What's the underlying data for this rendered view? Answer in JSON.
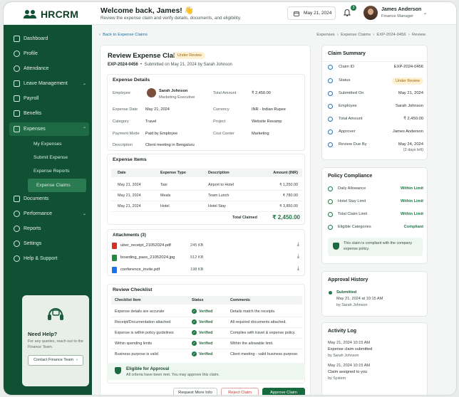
{
  "app": {
    "name": "HRCRM"
  },
  "header": {
    "welcome": "Welcome back, James! 👋",
    "subtitle": "Review the expense claim and verify details, documents, and eligibility.",
    "date": "May 21, 2024",
    "notification_count": "3",
    "user_name": "James Anderson",
    "user_role": "Finance Manager"
  },
  "sidebar": {
    "items": [
      {
        "label": "Dashboard"
      },
      {
        "label": "Profile"
      },
      {
        "label": "Attendance"
      },
      {
        "label": "Leave Management"
      },
      {
        "label": "Payroll"
      },
      {
        "label": "Benefits"
      },
      {
        "label": "Expenses"
      },
      {
        "label": "Documents"
      },
      {
        "label": "Performance"
      },
      {
        "label": "Reports"
      },
      {
        "label": "Settings"
      },
      {
        "label": "Help & Support"
      }
    ],
    "expenses_sub": [
      {
        "label": "My Expenses"
      },
      {
        "label": "Submit Expense"
      },
      {
        "label": "Expense Reports"
      },
      {
        "label": "Expense Claims"
      }
    ],
    "help": {
      "title": "Need Help?",
      "text": "For any queries, reach out to the Finance Team.",
      "button": "Contact Finance Team"
    }
  },
  "breadcrumb": {
    "back": "Back to Expense Claims",
    "trail": [
      "Expenses",
      "Expense Claims",
      "EXP-2024-0456",
      "Review"
    ]
  },
  "claim": {
    "title": "Review Expense Claim",
    "status": "Under Review",
    "id": "EXP-2024-0456",
    "submitted": "Submitted on May 21, 2024 by Sarah Johnson"
  },
  "details": {
    "heading": "Expense Details",
    "employee_label": "Employee",
    "employee_name": "Sarah Johnson",
    "employee_role": "Marketing Executive",
    "total_label": "Total Amount",
    "total_value": "₹ 2,450.00",
    "date_label": "Expense Date",
    "date_value": "May 21, 2024",
    "currency_label": "Currency",
    "currency_value": "INR - Indian Rupee",
    "category_label": "Category",
    "category_value": "Travel",
    "project_label": "Project",
    "project_value": "Website Revamp",
    "payment_label": "Payment Mode",
    "payment_value": "Paid by Employee",
    "cost_label": "Cost Center",
    "cost_value": "Marketing",
    "desc_label": "Description",
    "desc_value": "Client meeting in Bengaluru"
  },
  "items": {
    "heading": "Expense Items",
    "columns": [
      "Date",
      "Expense Type",
      "Description",
      "Amount (INR)"
    ],
    "rows": [
      {
        "date": "May 21, 2024",
        "type": "Taxi",
        "desc": "Airport to Hotel",
        "amount": "₹ 1,250.00"
      },
      {
        "date": "May 21, 2024",
        "type": "Meals",
        "desc": "Team Lunch",
        "amount": "₹ 780.00"
      },
      {
        "date": "May 21, 2024",
        "type": "Hotel",
        "desc": "Hotel Stay",
        "amount": "₹ 3,850.00"
      }
    ],
    "total_label": "Total Claimed",
    "total_value": "₹ 2,450.00"
  },
  "attachments": {
    "heading": "Attachments (3)",
    "files": [
      {
        "name": "uber_receipt_21052024.pdf",
        "size": "245 KB",
        "color": "#d93025"
      },
      {
        "name": "boarding_pass_21052024.jpg",
        "size": "512 KB",
        "color": "#1e8e3e"
      },
      {
        "name": "conference_invite.pdf",
        "size": "198 KB",
        "color": "#1a73e8"
      }
    ]
  },
  "checklist": {
    "heading": "Review Checklist",
    "columns": [
      "Checklist Item",
      "Status",
      "Comments"
    ],
    "rows": [
      {
        "item": "Expense details are accurate",
        "status": "Verified",
        "comment": "Details match the receipts."
      },
      {
        "item": "Receipt/Documentation attached",
        "status": "Verified",
        "comment": "All required documents attached."
      },
      {
        "item": "Expense is within policy guidelines",
        "status": "Verified",
        "comment": "Complies with travel & expense policy."
      },
      {
        "item": "Within spending limits",
        "status": "Verified",
        "comment": "Within the allowable limit."
      },
      {
        "item": "Business purpose is valid",
        "status": "Verified",
        "comment": "Client meeting - valid business purpose."
      }
    ]
  },
  "eligibility": {
    "title": "Eligible for Approval",
    "text": "All criteria have been met. You may approve this claim."
  },
  "actions": {
    "request": "Request More Info",
    "reject": "Reject Claim",
    "approve": "Approve Claim"
  },
  "summary": {
    "heading": "Claim Summary",
    "rows": [
      {
        "k": "Claim ID",
        "v": "EXP-2024-0456"
      },
      {
        "k": "Status",
        "v": "Under Review"
      },
      {
        "k": "Submitted On",
        "v": "May 21, 2024"
      },
      {
        "k": "Employee",
        "v": "Sarah Johnson"
      },
      {
        "k": "Total Amount",
        "v": "₹ 2,450.00"
      },
      {
        "k": "Approver",
        "v": "James Anderson"
      },
      {
        "k": "Review Due By",
        "v": "May 24, 2024",
        "v2": "(2 days left)"
      }
    ]
  },
  "policy": {
    "heading": "Policy Compliance",
    "rows": [
      {
        "k": "Daily Allowance",
        "v": "Within Limit"
      },
      {
        "k": "Hotel Stay Limit",
        "v": "Within Limit"
      },
      {
        "k": "Total Claim Limit",
        "v": "Within Limit"
      },
      {
        "k": "Eligible Categories",
        "v": "Compliant"
      }
    ],
    "note": "This claim is compliant with the company expense policy."
  },
  "approval": {
    "heading": "Approval History",
    "status": "Submitted",
    "time": "May 21, 2024 at 10:15 AM",
    "by": "by Sarah Johnson"
  },
  "activity": {
    "heading": "Activity Log",
    "entries": [
      {
        "time": "May 21, 2024 10:15 AM",
        "text": "Expense claim submitted",
        "by": "by Sarah Johnson"
      },
      {
        "time": "May 21, 2024 10:15 AM",
        "text": "Claim assigned to you",
        "by": "by System"
      }
    ]
  },
  "colors": {
    "brand": "#0f5132",
    "accent": "#1c7a45",
    "link": "#1d6fa3",
    "warning": "#fdf0d3"
  }
}
